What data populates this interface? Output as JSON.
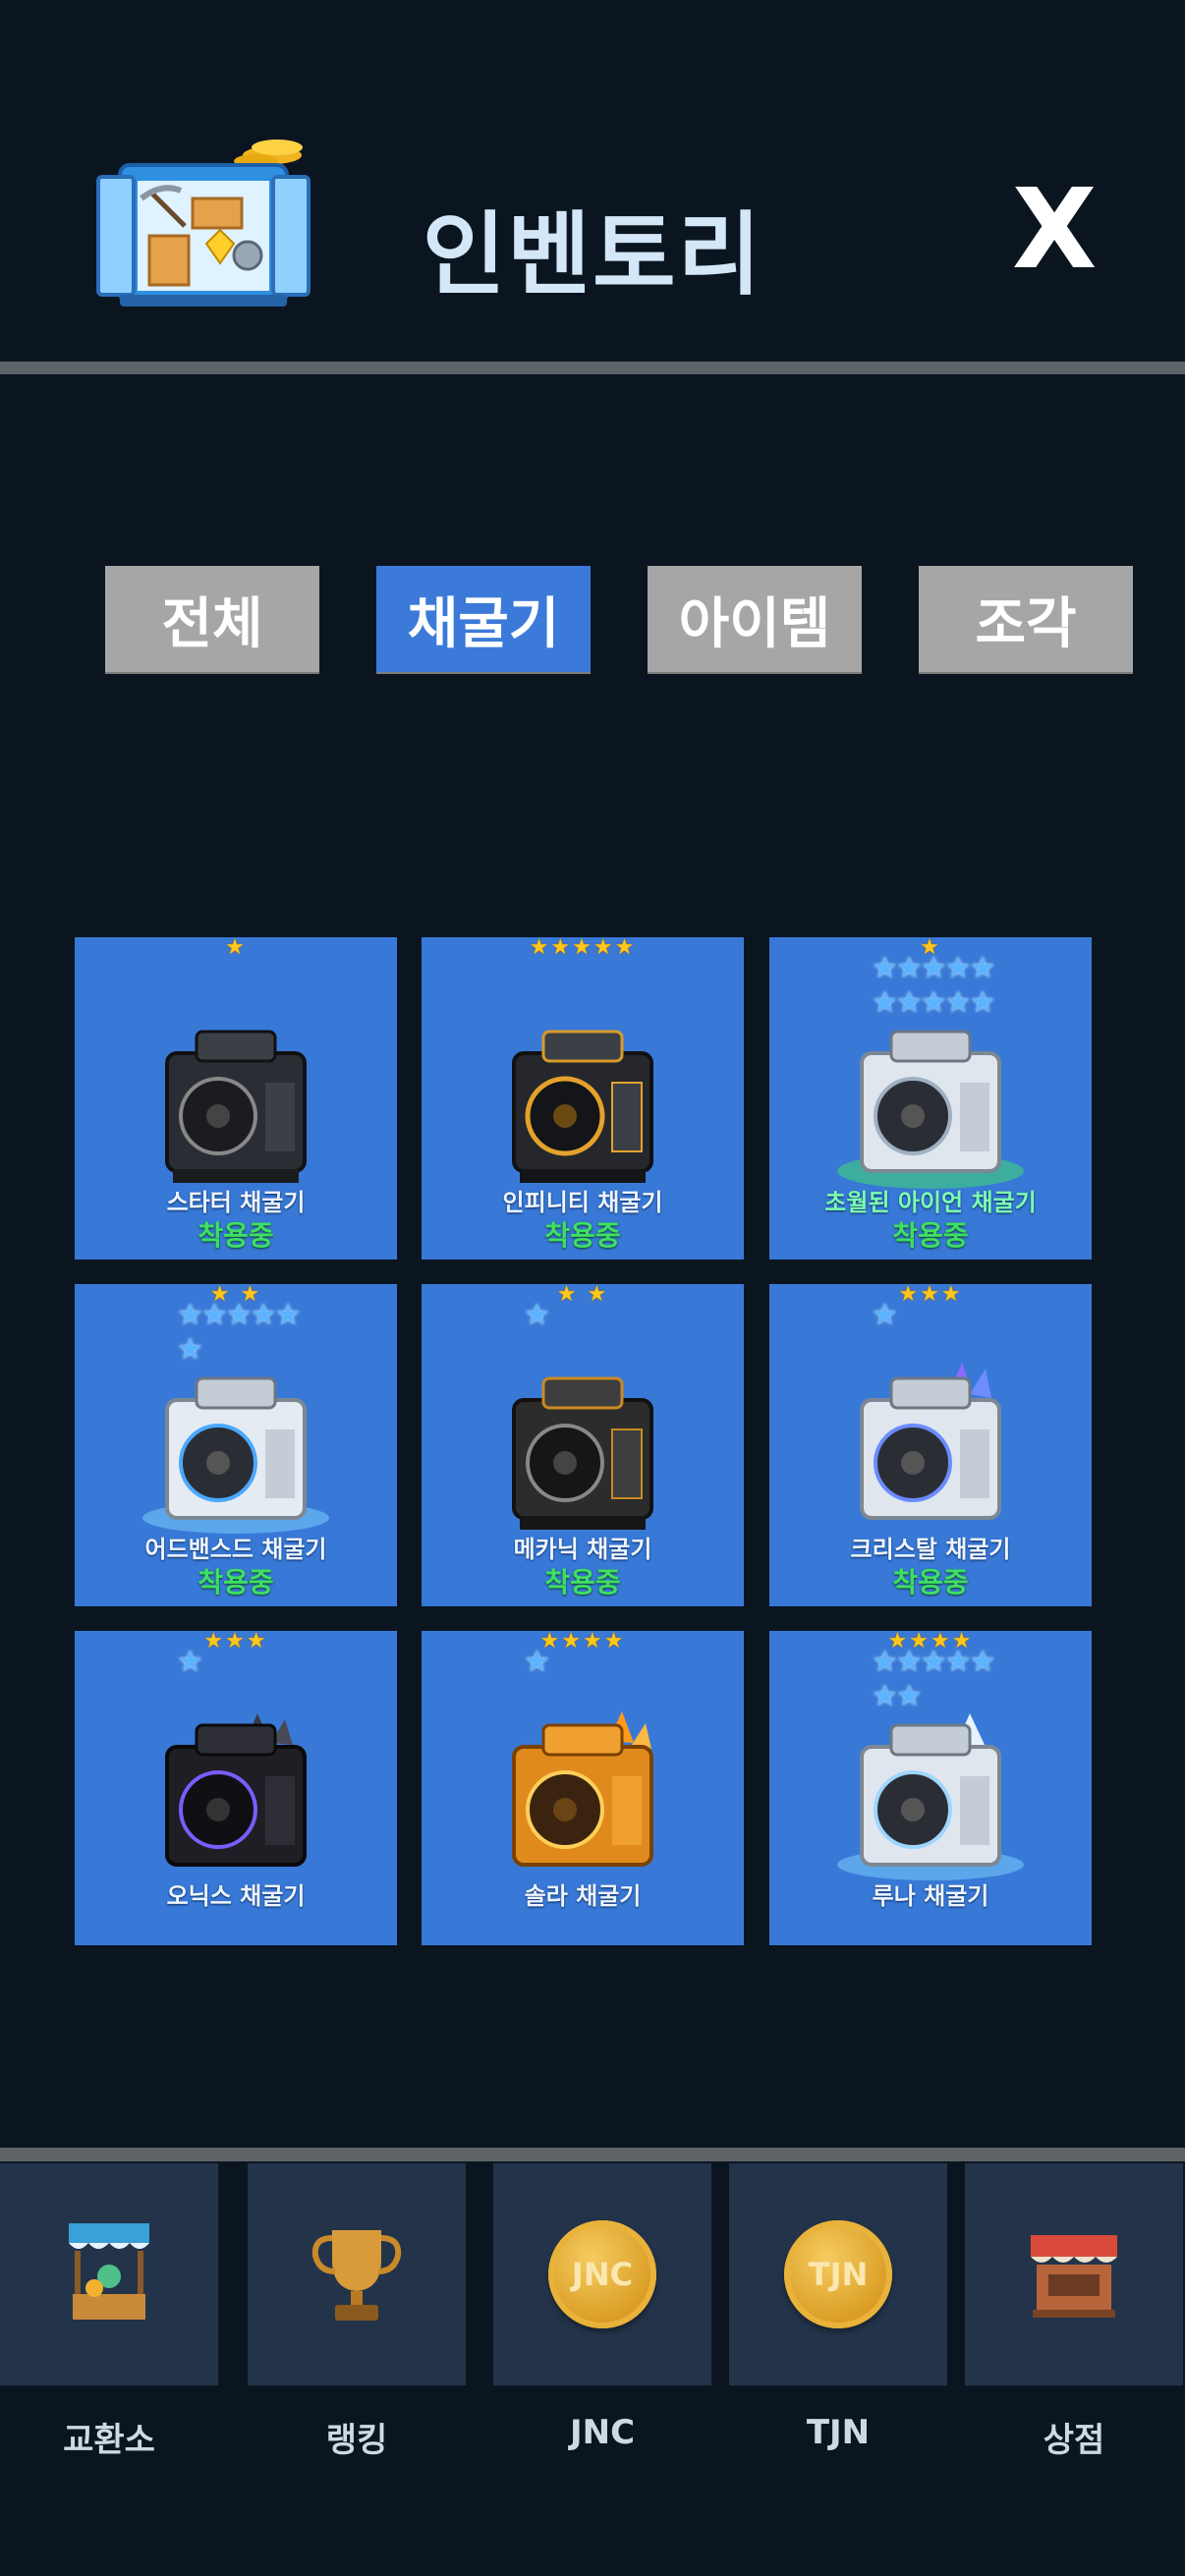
{
  "header": {
    "title": "인벤토리",
    "close_label": "X"
  },
  "tabs": [
    {
      "label": "전체",
      "active": false
    },
    {
      "label": "채굴기",
      "active": true
    },
    {
      "label": "아이템",
      "active": false
    },
    {
      "label": "조각",
      "active": false
    }
  ],
  "miners": [
    {
      "name": "스타터 채굴기",
      "status": "착용중",
      "gold_stars": 1,
      "blue_stars": 0,
      "style": "black"
    },
    {
      "name": "인피니티 채굴기",
      "status": "착용중",
      "gold_stars": 5,
      "blue_stars": 0,
      "style": "black-gold"
    },
    {
      "name": "초월된 아이언 채굴기",
      "status": "착용중",
      "gold_stars": 1,
      "blue_stars": 10,
      "style": "white-green"
    },
    {
      "name": "어드밴스드 채굴기",
      "status": "착용중",
      "gold_stars": 2,
      "blue_stars": 6,
      "style": "white-blue"
    },
    {
      "name": "메카닉 채굴기",
      "status": "착용중",
      "gold_stars": 2,
      "blue_stars": 1,
      "style": "black-gold"
    },
    {
      "name": "크리스탈 채굴기",
      "status": "착용중",
      "gold_stars": 3,
      "blue_stars": 1,
      "style": "white-crystal"
    },
    {
      "name": "오닉스 채굴기",
      "status": "",
      "gold_stars": 3,
      "blue_stars": 1,
      "style": "onyx"
    },
    {
      "name": "솔라 채굴기",
      "status": "",
      "gold_stars": 4,
      "blue_stars": 1,
      "style": "solar"
    },
    {
      "name": "루나 채굴기",
      "status": "",
      "gold_stars": 4,
      "blue_stars": 7,
      "style": "luna"
    }
  ],
  "nav": [
    {
      "label": "교환소",
      "icon": "exchange-stall-icon"
    },
    {
      "label": "랭킹",
      "icon": "trophy-icon"
    },
    {
      "label": "JNC",
      "icon": "jnc-coin-icon",
      "coin_text": "JNC"
    },
    {
      "label": "TJN",
      "icon": "tjn-coin-icon",
      "coin_text": "TJN"
    },
    {
      "label": "상점",
      "icon": "shop-icon"
    }
  ],
  "colors": {
    "background": "#0b1520",
    "tab_active": "#3b7ad9",
    "tab_inactive": "#a6a6a6",
    "card": "#3879d7",
    "equipped_green": "#3ee063",
    "nav_box": "#23344a"
  }
}
